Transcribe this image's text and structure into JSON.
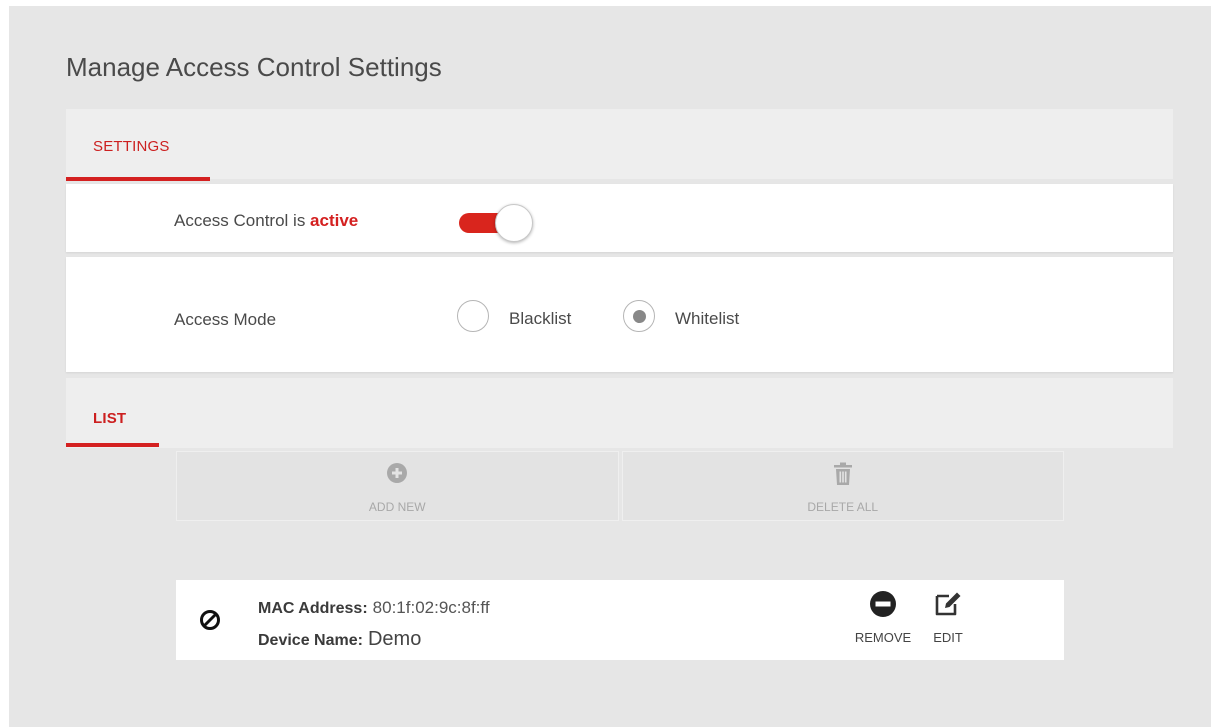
{
  "page": {
    "title": "Manage Access Control Settings"
  },
  "tabs": {
    "settings": "SETTINGS",
    "list": "LIST"
  },
  "access_control": {
    "label_prefix": "Access Control is ",
    "status_word": "active",
    "enabled": true,
    "accent_color": "#d42020"
  },
  "access_mode": {
    "label": "Access Mode",
    "options": [
      {
        "label": "Blacklist",
        "selected": false
      },
      {
        "label": "Whitelist",
        "selected": true
      }
    ]
  },
  "list_actions": {
    "add_new": {
      "label": "ADD NEW",
      "icon": "plus-circle-icon"
    },
    "delete_all": {
      "label": "DELETE ALL",
      "icon": "trash-icon"
    }
  },
  "devices": [
    {
      "status_icon": "block-icon",
      "mac_key": "MAC Address:",
      "mac_value": "80:1f:02:9c:8f:ff",
      "name_key": "Device Name:",
      "name_value": "Demo",
      "remove_label": "REMOVE",
      "edit_label": "EDIT"
    }
  ]
}
